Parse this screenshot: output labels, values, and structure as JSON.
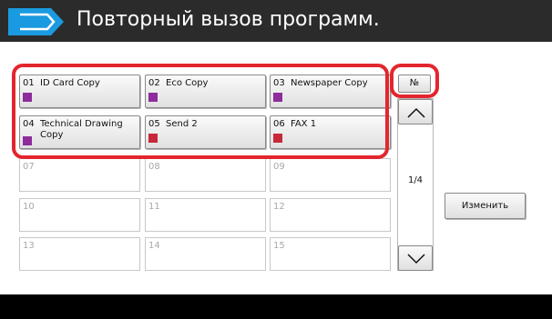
{
  "header": {
    "title": "Повторный вызов программ."
  },
  "programs": [
    {
      "num": "01",
      "name": "ID Card Copy",
      "icon": "copy-icon"
    },
    {
      "num": "02",
      "name": "Eco Copy",
      "icon": "copy-icon"
    },
    {
      "num": "03",
      "name": "Newspaper Copy",
      "icon": "copy-icon"
    },
    {
      "num": "04",
      "name": "Technical Drawing Copy",
      "icon": "copy-icon"
    },
    {
      "num": "05",
      "name": "Send 2",
      "icon": "send-icon"
    },
    {
      "num": "06",
      "name": "FAX 1",
      "icon": "fax-icon"
    },
    {
      "num": "07",
      "name": ""
    },
    {
      "num": "08",
      "name": ""
    },
    {
      "num": "09",
      "name": ""
    },
    {
      "num": "10",
      "name": ""
    },
    {
      "num": "11",
      "name": ""
    },
    {
      "num": "12",
      "name": ""
    },
    {
      "num": "13",
      "name": ""
    },
    {
      "num": "14",
      "name": ""
    },
    {
      "num": "15",
      "name": ""
    }
  ],
  "sort_button": "№",
  "pagination": {
    "page": "1/4"
  },
  "edit_button": "Изменить",
  "colors": {
    "header_bg": "#2b2b2b",
    "accent": "#1a9ae0",
    "highlight": "#e3262e",
    "copy_icon": "#8e2c9c",
    "send_icon": "#c8283a"
  }
}
